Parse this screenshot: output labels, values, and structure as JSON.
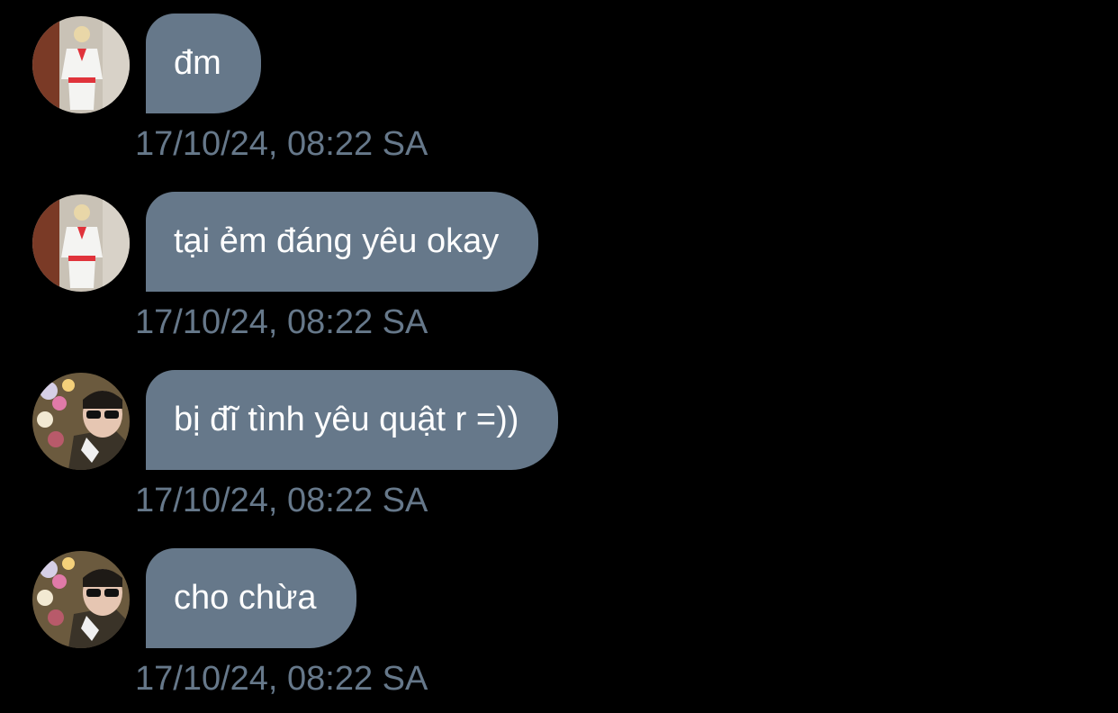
{
  "colors": {
    "background": "#000000",
    "bubble": "#66788a",
    "bubble_text": "#ffffff",
    "timestamp": "#66788a"
  },
  "messages": [
    {
      "sender_avatar": "avatar-person-white-outfit",
      "text": "đm",
      "timestamp": "17/10/24, 08:22 SA"
    },
    {
      "sender_avatar": "avatar-person-white-outfit",
      "text": "tại ẻm đáng yêu okay",
      "timestamp": "17/10/24, 08:22 SA"
    },
    {
      "sender_avatar": "avatar-person-sunglasses",
      "text": "bị đĩ tình yêu quật r =))",
      "timestamp": "17/10/24, 08:22 SA"
    },
    {
      "sender_avatar": "avatar-person-sunglasses",
      "text": "cho chừa",
      "timestamp": "17/10/24, 08:22 SA"
    }
  ]
}
